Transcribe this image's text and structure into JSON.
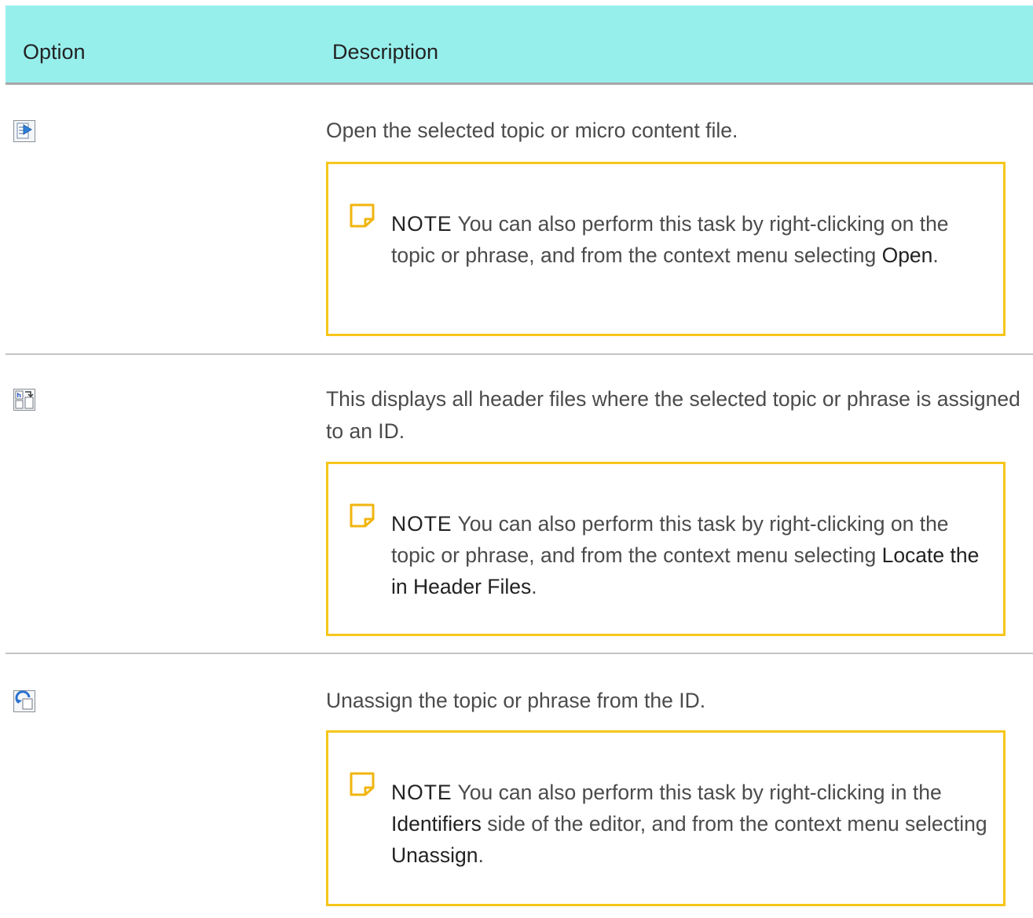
{
  "table": {
    "headers": {
      "option": "Option",
      "description": "Description"
    },
    "rows": [
      {
        "icon": "open-topic-icon",
        "description": "Open the selected topic or micro content file.",
        "note": {
          "label": "NOTE",
          "text": "You can also perform this task by right-clicking on the topic or phrase, and from the context menu selecting",
          "ui_term": "Open",
          "end": "."
        }
      },
      {
        "icon": "locate-header-files-icon",
        "description": "This displays all header files where the selected topic or phrase is assigned to an ID.",
        "note": {
          "label": "NOTE",
          "text": "You can also perform this task by right-clicking on the topic or phrase, and from the context menu selecting",
          "ui_term": "Locate the in Header Files",
          "end": "."
        }
      },
      {
        "icon": "unassign-icon",
        "description": "Unassign the topic or phrase from the ID.",
        "note": {
          "label": "NOTE",
          "text_before": "You can also perform this task by right-clicking in the",
          "ui_term_1": "Identifiers",
          "text_middle": "side of the editor, and from the context menu selecting",
          "ui_term_2": "Unassign",
          "end": "."
        }
      }
    ]
  },
  "colors": {
    "header_background": "#97efec",
    "note_border": "#f6c619",
    "divider": "#c4c4c4"
  }
}
